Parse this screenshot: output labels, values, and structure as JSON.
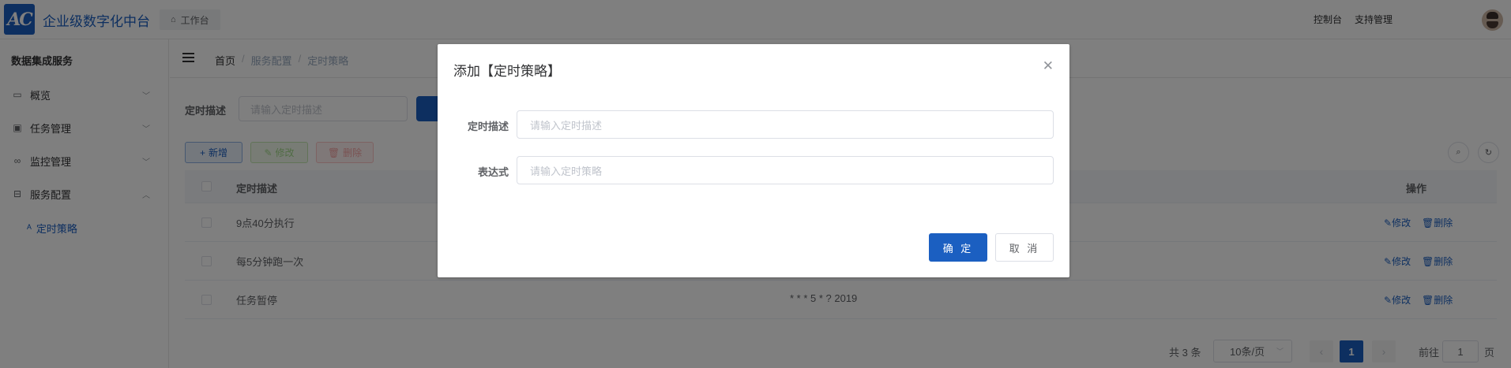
{
  "header": {
    "logo_text": "AC",
    "app_title": "企业级数字化中台",
    "home_tab": "工作台",
    "links": [
      "控制台",
      "支持管理"
    ]
  },
  "sidebar": {
    "title": "数据集成服务",
    "items": [
      {
        "label": "概览",
        "icon": "monitor-icon"
      },
      {
        "label": "任务管理",
        "icon": "bus-icon"
      },
      {
        "label": "监控管理",
        "icon": "bike-icon"
      },
      {
        "label": "服务配置",
        "icon": "devices-icon"
      }
    ],
    "sub_item": "定时策略"
  },
  "breadcrumb": [
    "首页",
    "服务配置",
    "定时策略"
  ],
  "search": {
    "label": "定时描述",
    "placeholder": "请输入定时描述"
  },
  "toolbar": {
    "add": "新增",
    "edit": "修改",
    "delete": "删除"
  },
  "table": {
    "columns": [
      "定时描述",
      "操作"
    ],
    "rows": [
      {
        "desc": "9点40分执行",
        "expr": ""
      },
      {
        "desc": "每5分钟跑一次",
        "expr": ""
      },
      {
        "desc": "任务暂停",
        "expr": "* * * 5 * ? 2019"
      }
    ],
    "op_edit": "修改",
    "op_delete": "删除"
  },
  "pagination": {
    "total": "共 3 条",
    "page_size": "10条/页",
    "current": "1",
    "goto_label": "前往",
    "goto_value": "1",
    "page_suffix": "页"
  },
  "dialog": {
    "title": "添加【定时策略】",
    "fields": [
      {
        "label": "定时描述",
        "placeholder": "请输入定时描述"
      },
      {
        "label": "表达式",
        "placeholder": "请输入定时策略"
      }
    ],
    "confirm": "确 定",
    "cancel": "取 消"
  },
  "colors": {
    "primary": "#1b5fc1",
    "overlay": "rgba(0,0,0,0.5)"
  }
}
